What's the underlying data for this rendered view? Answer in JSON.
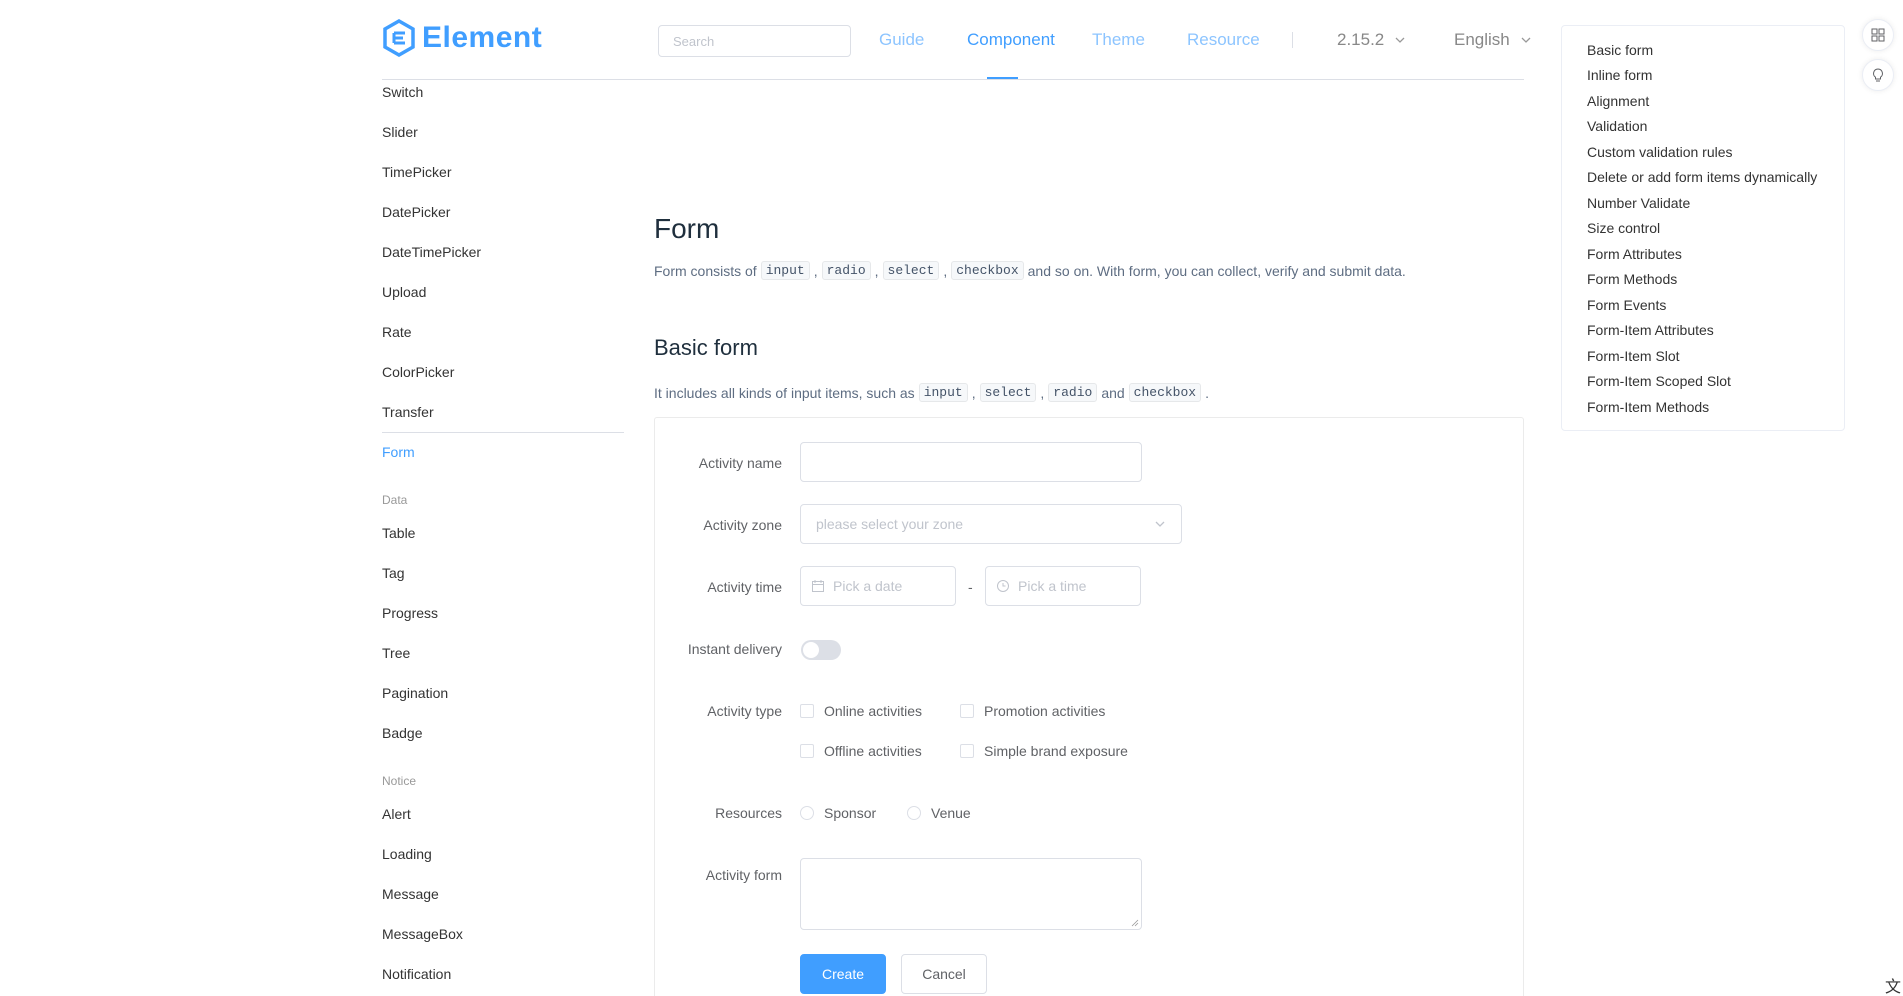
{
  "header": {
    "logo_text": "Element",
    "search_placeholder": "Search",
    "nav": [
      "Guide",
      "Component",
      "Theme",
      "Resource"
    ],
    "version": "2.15.2",
    "language": "English"
  },
  "sidebar": {
    "items_top": [
      "Switch",
      "Slider",
      "TimePicker",
      "DatePicker",
      "DateTimePicker",
      "Upload",
      "Rate",
      "ColorPicker",
      "Transfer"
    ],
    "active": "Form",
    "group_data": "Data",
    "items_data": [
      "Table",
      "Tag",
      "Progress",
      "Tree",
      "Pagination",
      "Badge"
    ],
    "group_notice": "Notice",
    "items_notice": [
      "Alert",
      "Loading",
      "Message",
      "MessageBox",
      "Notification"
    ]
  },
  "main": {
    "title": "Form",
    "desc_prefix": "Form consists of",
    "desc_codes": [
      "input",
      "radio",
      "select",
      "checkbox"
    ],
    "desc_suffix": "and so on. With form, you can collect, verify and submit data.",
    "section_title": "Basic form",
    "section_desc_prefix": "It includes all kinds of input items, such as",
    "section_codes": [
      "input",
      "select",
      "radio",
      "checkbox"
    ],
    "section_and": "and",
    "comma": ",",
    "period": "."
  },
  "form": {
    "activity_name_label": "Activity name",
    "activity_name_value": "",
    "activity_zone_label": "Activity zone",
    "activity_zone_placeholder": "please select your zone",
    "activity_time_label": "Activity time",
    "date_placeholder": "Pick a date",
    "time_separator": "-",
    "time_placeholder": "Pick a time",
    "instant_delivery_label": "Instant delivery",
    "instant_delivery_on": false,
    "activity_type_label": "Activity type",
    "activity_types": [
      "Online activities",
      "Promotion activities",
      "Offline activities",
      "Simple brand exposure"
    ],
    "resources_label": "Resources",
    "resources": [
      "Sponsor",
      "Venue"
    ],
    "activity_form_label": "Activity form",
    "create_label": "Create",
    "cancel_label": "Cancel"
  },
  "toc": [
    "Basic form",
    "Inline form",
    "Alignment",
    "Validation",
    "Custom validation rules",
    "Delete or add form items dynamically",
    "Number Validate",
    "Size control",
    "Form Attributes",
    "Form Methods",
    "Form Events",
    "Form-Item Attributes",
    "Form-Item Slot",
    "Form-Item Scoped Slot",
    "Form-Item Methods"
  ],
  "colors": {
    "primary": "#409eff",
    "border": "#dcdfe6",
    "text": "#606266"
  },
  "icons": {
    "theme_picker": "grid-icon",
    "tips": "lightbulb-icon",
    "translate": "translate-icon"
  },
  "translate_glyph": "文A"
}
